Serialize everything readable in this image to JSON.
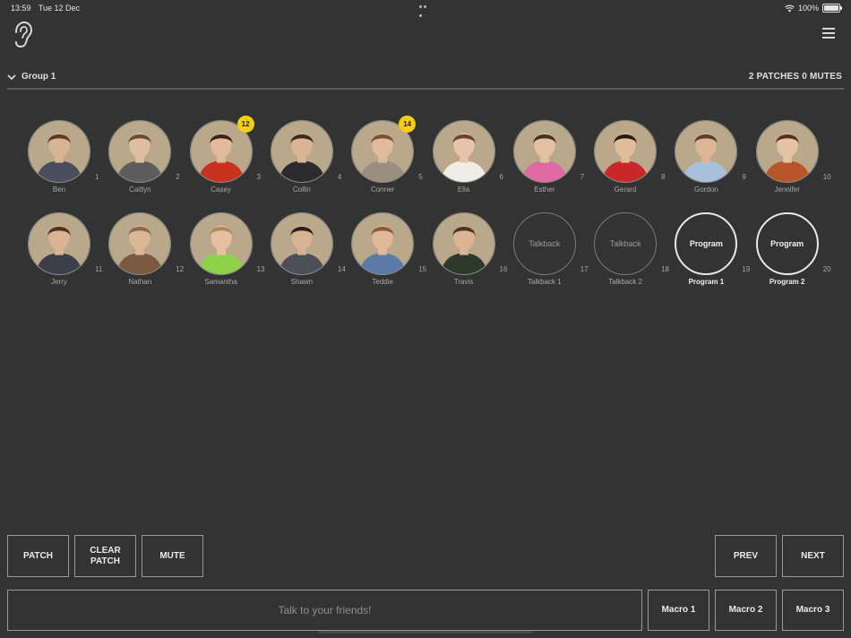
{
  "status_bar": {
    "time": "13:59",
    "date": "Tue 12 Dec",
    "battery": "100%",
    "battery_level": 1.0
  },
  "header": {
    "logo_icon": "ear-icon",
    "menu_icon": "hamburger-menu-icon"
  },
  "group": {
    "name": "Group 1",
    "summary": "2 PATCHES 0 MUTES",
    "expanded": true
  },
  "members": [
    {
      "name": "Ben",
      "number": "1",
      "type": "photo",
      "skin": "#d8b394",
      "hair": "#5a3a22",
      "shirt": "#4a4e5c"
    },
    {
      "name": "Caitlyn",
      "number": "2",
      "type": "photo",
      "skin": "#e0bea2",
      "hair": "#6b4a33",
      "shirt": "#5d5d5d"
    },
    {
      "name": "Casey",
      "number": "3",
      "type": "photo",
      "badge": "12",
      "skin": "#e2b99c",
      "hair": "#3a2418",
      "shirt": "#c8321f"
    },
    {
      "name": "Collin",
      "number": "4",
      "type": "photo",
      "skin": "#d9b497",
      "hair": "#3e2a1c",
      "shirt": "#2c2c2e"
    },
    {
      "name": "Conner",
      "number": "5",
      "type": "photo",
      "badge": "14",
      "skin": "#e0bb9b",
      "hair": "#7a5232",
      "shirt": "#9a8e82"
    },
    {
      "name": "Ella",
      "number": "6",
      "type": "photo",
      "skin": "#e6c4a8",
      "hair": "#6b4128",
      "shirt": "#f0ece6"
    },
    {
      "name": "Esther",
      "number": "7",
      "type": "photo",
      "skin": "#e4c0a3",
      "hair": "#4a2e1e",
      "shirt": "#e26aa4"
    },
    {
      "name": "Gerard",
      "number": "8",
      "type": "photo",
      "skin": "#e2bb9b",
      "hair": "#2a1c14",
      "shirt": "#c82828"
    },
    {
      "name": "Gordon",
      "number": "9",
      "type": "photo",
      "skin": "#dcb697",
      "hair": "#5c3e28",
      "shirt": "#a8c0dc"
    },
    {
      "name": "Jennifer",
      "number": "10",
      "type": "photo",
      "skin": "#e6c2a4",
      "hair": "#5a2e1e",
      "shirt": "#b8552a"
    },
    {
      "name": "Jerry",
      "number": "11",
      "type": "photo",
      "skin": "#dab395",
      "hair": "#4a3222",
      "shirt": "#3c3f4a"
    },
    {
      "name": "Nathan",
      "number": "12",
      "type": "photo",
      "skin": "#ddb698",
      "hair": "#8a6a4a",
      "shirt": "#7a5a40"
    },
    {
      "name": "Samantha",
      "number": "13",
      "type": "photo",
      "skin": "#e6c0a2",
      "hair": "#b08a5a",
      "shirt": "#8fd04a"
    },
    {
      "name": "Shawn",
      "number": "14",
      "type": "photo",
      "skin": "#d8b294",
      "hair": "#2e2018",
      "shirt": "#4c4f58"
    },
    {
      "name": "Teddie",
      "number": "15",
      "type": "photo",
      "skin": "#e0b99a",
      "hair": "#8a5a34",
      "shirt": "#5c7aa8"
    },
    {
      "name": "Travis",
      "number": "16",
      "type": "photo",
      "skin": "#dab495",
      "hair": "#4a3424",
      "shirt": "#2c3a2c"
    },
    {
      "name": "Talkback 1",
      "number": "17",
      "type": "text",
      "circle_text": "Talkback"
    },
    {
      "name": "Talkback 2",
      "number": "18",
      "type": "text",
      "circle_text": "Talkback"
    },
    {
      "name": "Program 1",
      "number": "19",
      "type": "program",
      "circle_text": "Program"
    },
    {
      "name": "Program 2",
      "number": "20",
      "type": "program",
      "circle_text": "Program"
    }
  ],
  "actions": {
    "patch": "PATCH",
    "clear_patch_line1": "CLEAR",
    "clear_patch_line2": "PATCH",
    "mute": "MUTE",
    "prev": "PREV",
    "next": "NEXT"
  },
  "talk": {
    "placeholder": "Talk to your friends!"
  },
  "macros": [
    "Macro 1",
    "Macro 2",
    "Macro 3"
  ],
  "colors": {
    "background": "#333333",
    "badge": "#f5cd14",
    "border": "#9a9a9a"
  }
}
